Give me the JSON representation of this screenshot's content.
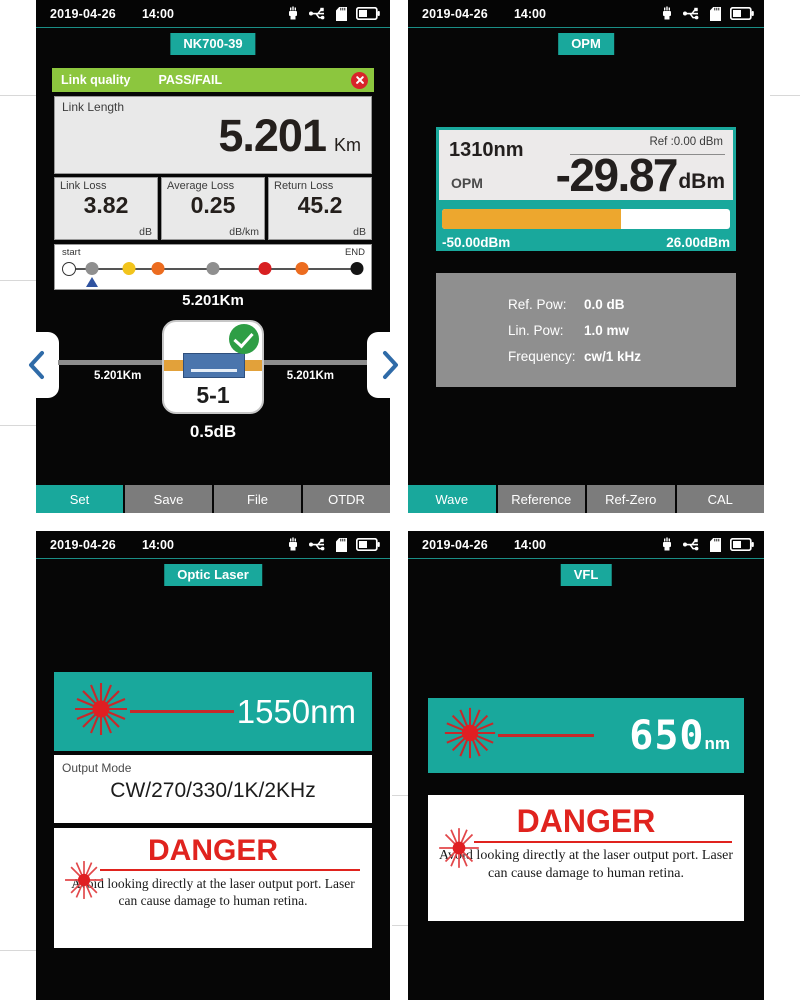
{
  "statusbar": {
    "date": "2019-04-26",
    "time": "14:00",
    "icons": [
      "power-plug-icon",
      "usb-icon",
      "sd-card-icon",
      "battery-icon"
    ]
  },
  "colors": {
    "teal": "#19a89c",
    "green_pass": "#8cc63e",
    "red_close": "#d8252a",
    "orange_bar": "#eda72e",
    "gray_panel": "#8f8f8f",
    "laser_red": "#c6292b",
    "danger_red": "#e0231e",
    "screen_bg": "#060606"
  },
  "panel_otdr": {
    "title": "NK700-39",
    "link_quality": {
      "label": "Link quality",
      "result": "PASS/FAIL",
      "close_icon": "close-circle-icon"
    },
    "link_length": {
      "label": "Link Length",
      "value": "5.201",
      "unit": "Km"
    },
    "metrics": [
      {
        "label": "Link Loss",
        "value": "3.82",
        "unit": "dB"
      },
      {
        "label": "Average Loss",
        "value": "0.25",
        "unit": "dB/km"
      },
      {
        "label": "Return Loss",
        "value": "45.2",
        "unit": "dB"
      }
    ],
    "linkmap": {
      "start_label": "start",
      "end_label": "END",
      "marker_position_pct": 8,
      "events": [
        {
          "position_pct": 0,
          "color": "#ffffff"
        },
        {
          "position_pct": 8,
          "color": "#8f8f8f"
        },
        {
          "position_pct": 21,
          "color": "#f2c41c"
        },
        {
          "position_pct": 31,
          "color": "#ec6c1f"
        },
        {
          "position_pct": 50,
          "color": "#8f8f8f"
        },
        {
          "position_pct": 68,
          "color": "#d81f21"
        },
        {
          "position_pct": 81,
          "color": "#ec6c1f"
        },
        {
          "position_pct": 100,
          "color": "#141414"
        }
      ]
    },
    "event_view": {
      "distance_top": "5.201Km",
      "distance_left": "5.201Km",
      "distance_right": "5.201Km",
      "event_id": "5-1",
      "event_loss": "0.5dB",
      "status_icon": "check-circle-icon",
      "prev_icon": "chevron-left-icon",
      "next_icon": "chevron-right-icon"
    },
    "tabs": [
      {
        "label": "Set",
        "active": true
      },
      {
        "label": "Save",
        "active": false
      },
      {
        "label": "File",
        "active": false
      },
      {
        "label": "OTDR",
        "active": false
      }
    ]
  },
  "panel_opm": {
    "title": "OPM",
    "reading": {
      "wavelength": "1310nm",
      "ref_label": "Ref :0.00  dBm",
      "mode_tag": "OPM",
      "value": "-29.87",
      "unit": "dBm"
    },
    "bar": {
      "fill_pct": 62,
      "min_label": "-50.00dBm",
      "max_label": "26.00dBm"
    },
    "info": [
      {
        "key": "Ref. Pow:",
        "value": "0.0 dB"
      },
      {
        "key": "Lin. Pow:",
        "value": "1.0 mw"
      },
      {
        "key": "Frequency:",
        "value": "cw/1 kHz"
      }
    ],
    "tabs": [
      {
        "label": "Wave",
        "active": true
      },
      {
        "label": "Reference",
        "active": false
      },
      {
        "label": "Ref-Zero",
        "active": false
      },
      {
        "label": "CAL",
        "active": false
      }
    ]
  },
  "panel_laser": {
    "title": "Optic Laser",
    "wavelength": {
      "number": "1550",
      "unit": "nm",
      "icon": "laser-burst-icon"
    },
    "output_mode": {
      "label": "Output Mode",
      "value": "CW/270/330/1K/2KHz"
    },
    "danger": {
      "heading": "DANGER",
      "body": "Avoid looking directly at the laser output port. Laser can cause damage to human retina.",
      "icon": "laser-burst-icon"
    }
  },
  "panel_vfl": {
    "title": "VFL",
    "wavelength": {
      "number": "650",
      "unit": "nm",
      "icon": "laser-burst-icon"
    },
    "danger": {
      "heading": "DANGER",
      "body": "Avoid looking directly at the laser output port. Laser can cause damage to human retina.",
      "icon": "laser-burst-icon"
    }
  }
}
